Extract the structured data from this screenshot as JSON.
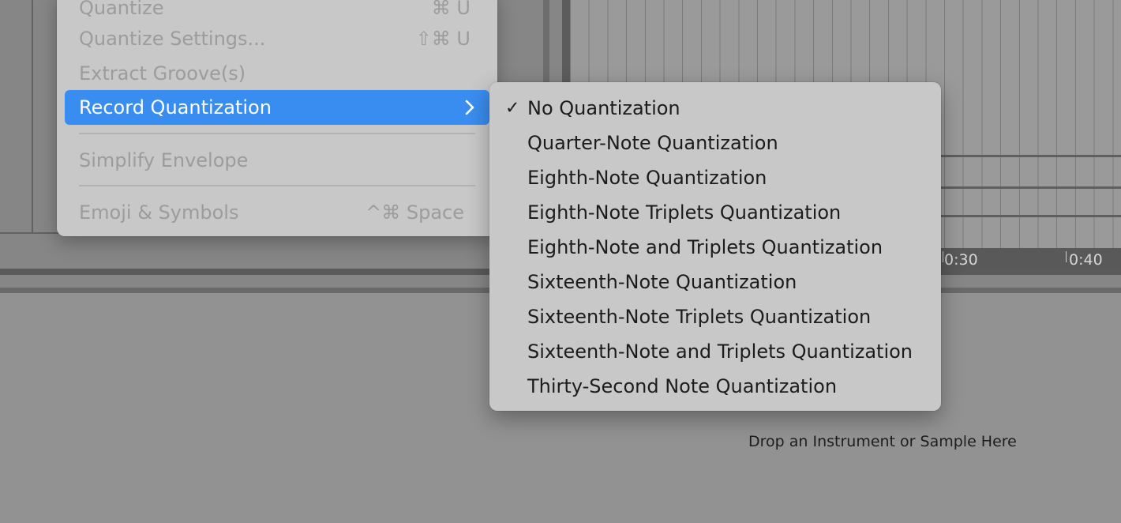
{
  "menu": {
    "items": [
      {
        "label": "Quantize",
        "shortcut": "⌘ U"
      },
      {
        "label": "Quantize Settings...",
        "shortcut": "⇧⌘ U"
      },
      {
        "label": "Extract Groove(s)",
        "shortcut": ""
      },
      {
        "label": "Record Quantization",
        "shortcut": ""
      },
      {
        "label": "Simplify Envelope",
        "shortcut": ""
      },
      {
        "label": "Emoji & Symbols",
        "shortcut": "^⌘ Space"
      }
    ]
  },
  "submenu": {
    "selected": "No Quantization",
    "check_mark": "✓",
    "items": [
      {
        "label": "No Quantization"
      },
      {
        "label": "Quarter-Note Quantization"
      },
      {
        "label": "Eighth-Note Quantization"
      },
      {
        "label": "Eighth-Note Triplets Quantization"
      },
      {
        "label": "Eighth-Note and Triplets Quantization"
      },
      {
        "label": "Sixteenth-Note Quantization"
      },
      {
        "label": "Sixteenth-Note Triplets Quantization"
      },
      {
        "label": "Sixteenth-Note and Triplets Quantization"
      },
      {
        "label": "Thirty-Second Note Quantization"
      }
    ]
  },
  "ruler": {
    "labels": [
      "0:30",
      "0:40"
    ]
  },
  "drop_hint": "Drop an Instrument or Sample Here",
  "colors": {
    "highlight": "#3a8df0",
    "menu_bg": "#c8c8c8",
    "disabled_text": "#9c9c9c"
  }
}
